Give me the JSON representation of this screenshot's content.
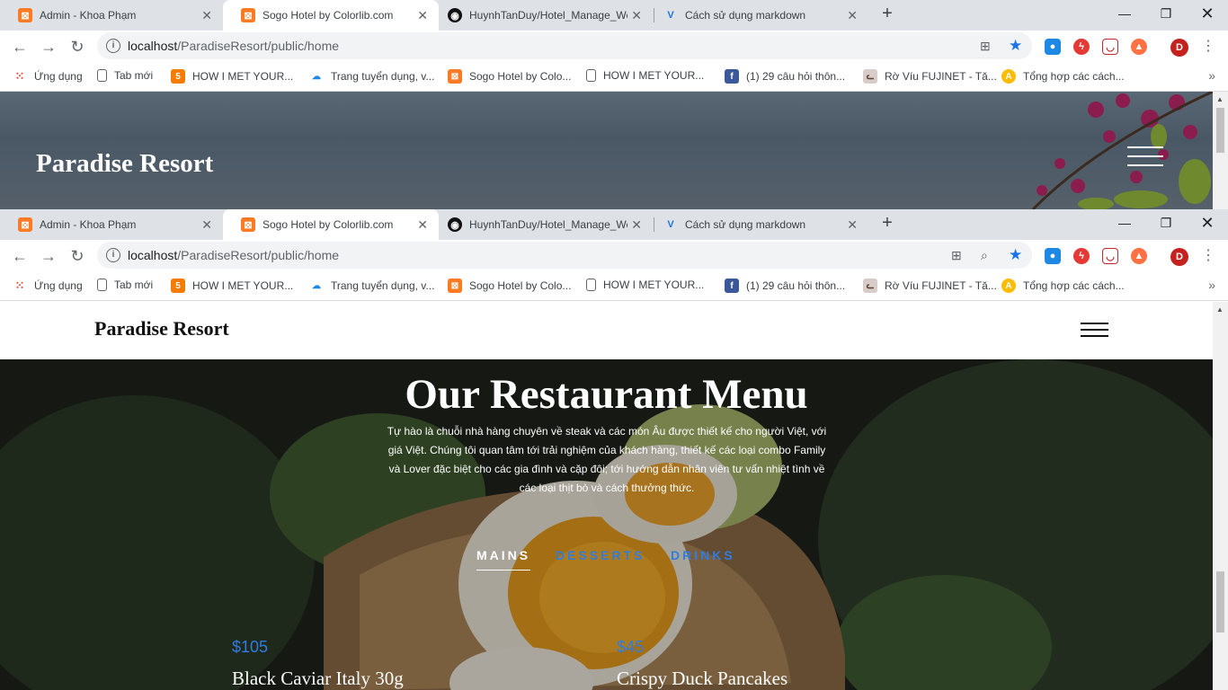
{
  "browser": {
    "tabs": [
      {
        "title": "Admin - Khoa Phạm",
        "icon": "xampp-icon"
      },
      {
        "title": "Sogo Hotel by Colorlib.com",
        "icon": "xampp-icon"
      },
      {
        "title": "HuynhTanDuy/Hotel_Manage_We",
        "icon": "github-icon"
      },
      {
        "title": "Cách sử dụng markdown",
        "icon": "v-icon"
      }
    ],
    "url_host": "localhost",
    "url_path": "/ParadiseResort/public/home",
    "profile_initial": "D",
    "bookmarks": [
      {
        "label": "Ứng dụng",
        "icon": "apps-grid-icon"
      },
      {
        "label": "Tab mới",
        "icon": "page-icon"
      },
      {
        "label": "HOW I MET YOUR...",
        "icon": "html-icon"
      },
      {
        "label": "Trang tuyển dụng, v...",
        "icon": "cloud-icon"
      },
      {
        "label": "Sogo Hotel by Colo...",
        "icon": "xampp-icon"
      },
      {
        "label": "HOW I MET YOUR...",
        "icon": "page-icon"
      },
      {
        "label": "(1) 29 câu hỏi thôn...",
        "icon": "facebook-icon"
      },
      {
        "label": "Rờ Víu FUJINET - Tă...",
        "icon": "cat-icon"
      },
      {
        "label": "Tổng hợp các cách...",
        "icon": "a-icon"
      }
    ],
    "colors": {
      "tabbar": "#dee1e6",
      "accent_star": "#1a73e8",
      "profile": "#c5221f"
    }
  },
  "hero": {
    "brand": "Paradise Resort"
  },
  "header": {
    "brand": "Paradise Resort"
  },
  "menu": {
    "title": "Our Restaurant Menu",
    "description": "Tự hào là chuỗi nhà hàng chuyên về steak và các món Âu được thiết kế cho người Việt, với giá Việt. Chúng tôi quan tâm tới trải nghiệm của khách hàng, thiết kế các loại combo Family và Lover đặc biệt cho các gia đình và cặp đôi; tới hướng dẫn nhân viên tư vấn nhiệt tình về các loại thịt bò và cách thưởng thức.",
    "tabs": [
      {
        "label": "MAINS",
        "active": true
      },
      {
        "label": "DESSERTS",
        "active": false
      },
      {
        "label": "DRINKS",
        "active": false
      }
    ],
    "items": [
      {
        "price": "$105",
        "name": "Black Caviar Italy 30g"
      },
      {
        "price": "$45",
        "name": "Crispy Duck Pancakes"
      }
    ],
    "colors": {
      "accent": "#2f7de1",
      "text": "#ffffff"
    }
  }
}
